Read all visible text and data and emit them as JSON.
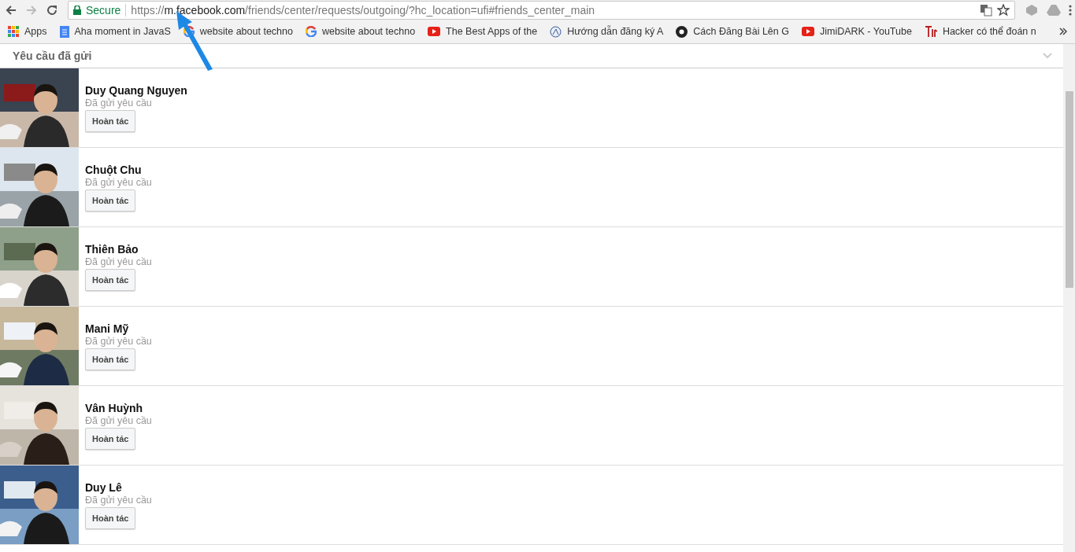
{
  "browser": {
    "security_label": "Secure",
    "url": {
      "scheme": "https://",
      "host": "m.facebook.com",
      "path": "/friends/center/requests/outgoing/?hc_location=ufi#friends_center_main"
    }
  },
  "bookmarks": [
    {
      "kind": "apps",
      "label": "Apps"
    },
    {
      "kind": "doc",
      "label": "Aha moment in JavaS"
    },
    {
      "kind": "google",
      "label": "website about techno"
    },
    {
      "kind": "google",
      "label": "website about techno"
    },
    {
      "kind": "youtube",
      "label": "The Best Apps of the"
    },
    {
      "kind": "globe",
      "label": "Hướng dẫn đăng ký A"
    },
    {
      "kind": "disc",
      "label": "Cách Đăng Bài Lên G"
    },
    {
      "kind": "youtube",
      "label": "JimiDARK - YouTube"
    },
    {
      "kind": "tin",
      "label": "Hacker có thể đoán n"
    }
  ],
  "section": {
    "title": "Yêu cầu đã gửi"
  },
  "requests": [
    {
      "name": "Duy Quang Nguyen",
      "status": "Đã gửi yêu cầu",
      "action": "Hoàn tác"
    },
    {
      "name": "Chuột Chu",
      "status": "Đã gửi yêu cầu",
      "action": "Hoàn tác"
    },
    {
      "name": "Thiên Bảo",
      "status": "Đã gửi yêu cầu",
      "action": "Hoàn tác"
    },
    {
      "name": "Mani Mỹ",
      "status": "Đã gửi yêu cầu",
      "action": "Hoàn tác"
    },
    {
      "name": "Vân Huỳnh",
      "status": "Đã gửi yêu cầu",
      "action": "Hoàn tác"
    },
    {
      "name": "Duy Lê",
      "status": "Đã gửi yêu cầu",
      "action": "Hoàn tác"
    }
  ]
}
